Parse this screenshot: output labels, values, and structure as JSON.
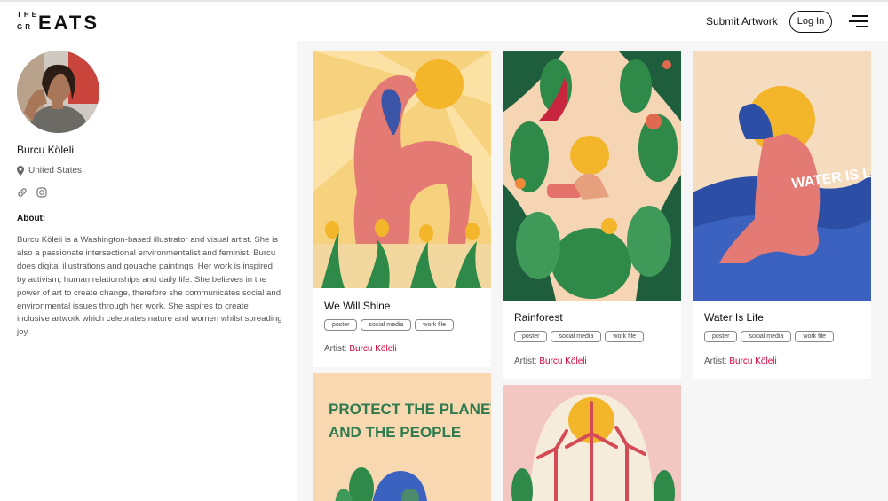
{
  "header": {
    "logo_the": "THE",
    "logo_greats": "GREATS",
    "submit_label": "Submit Artwork",
    "login_label": "Log In"
  },
  "profile": {
    "name": "Burcu Köleli",
    "location": "United States",
    "about_heading": "About:",
    "about_text": "Burcu Köleli is a Washington-based illustrator and visual artist. She is also a passionate intersectional environmentalist and feminist. Burcu does digital illustrations and gouache paintings. Her work is inspired by activism, human relationships and daily life. She believes in the power of art to create change, therefore she communicates social and environmental issues through her work. She aspires to create inclusive artwork which celebrates nature and women whilst spreading joy."
  },
  "cards": [
    {
      "title": "We Will Shine",
      "tags": [
        "poster",
        "social media",
        "work file"
      ],
      "artist_prefix": "Artist:",
      "artist": "Burcu Köleli"
    },
    {
      "title": "Rainforest",
      "tags": [
        "poster",
        "social media",
        "work file"
      ],
      "artist_prefix": "Artist:",
      "artist": "Burcu Köleli"
    },
    {
      "title": "Water Is Life",
      "tags": [
        "poster",
        "social media",
        "work file"
      ],
      "artist_prefix": "Artist:",
      "artist": "Burcu Köleli"
    }
  ],
  "art_text": {
    "water": "WATER IS LIFE",
    "protect_line1": "PROTECT THE PLANET",
    "protect_line2": "AND THE PEOPLE"
  },
  "icons": {
    "location": "map-pin-icon",
    "link": "link-icon",
    "instagram": "instagram-icon",
    "menu": "hamburger-menu-icon"
  },
  "colors": {
    "accent": "#d4003b",
    "background": "#f6f6f6"
  }
}
